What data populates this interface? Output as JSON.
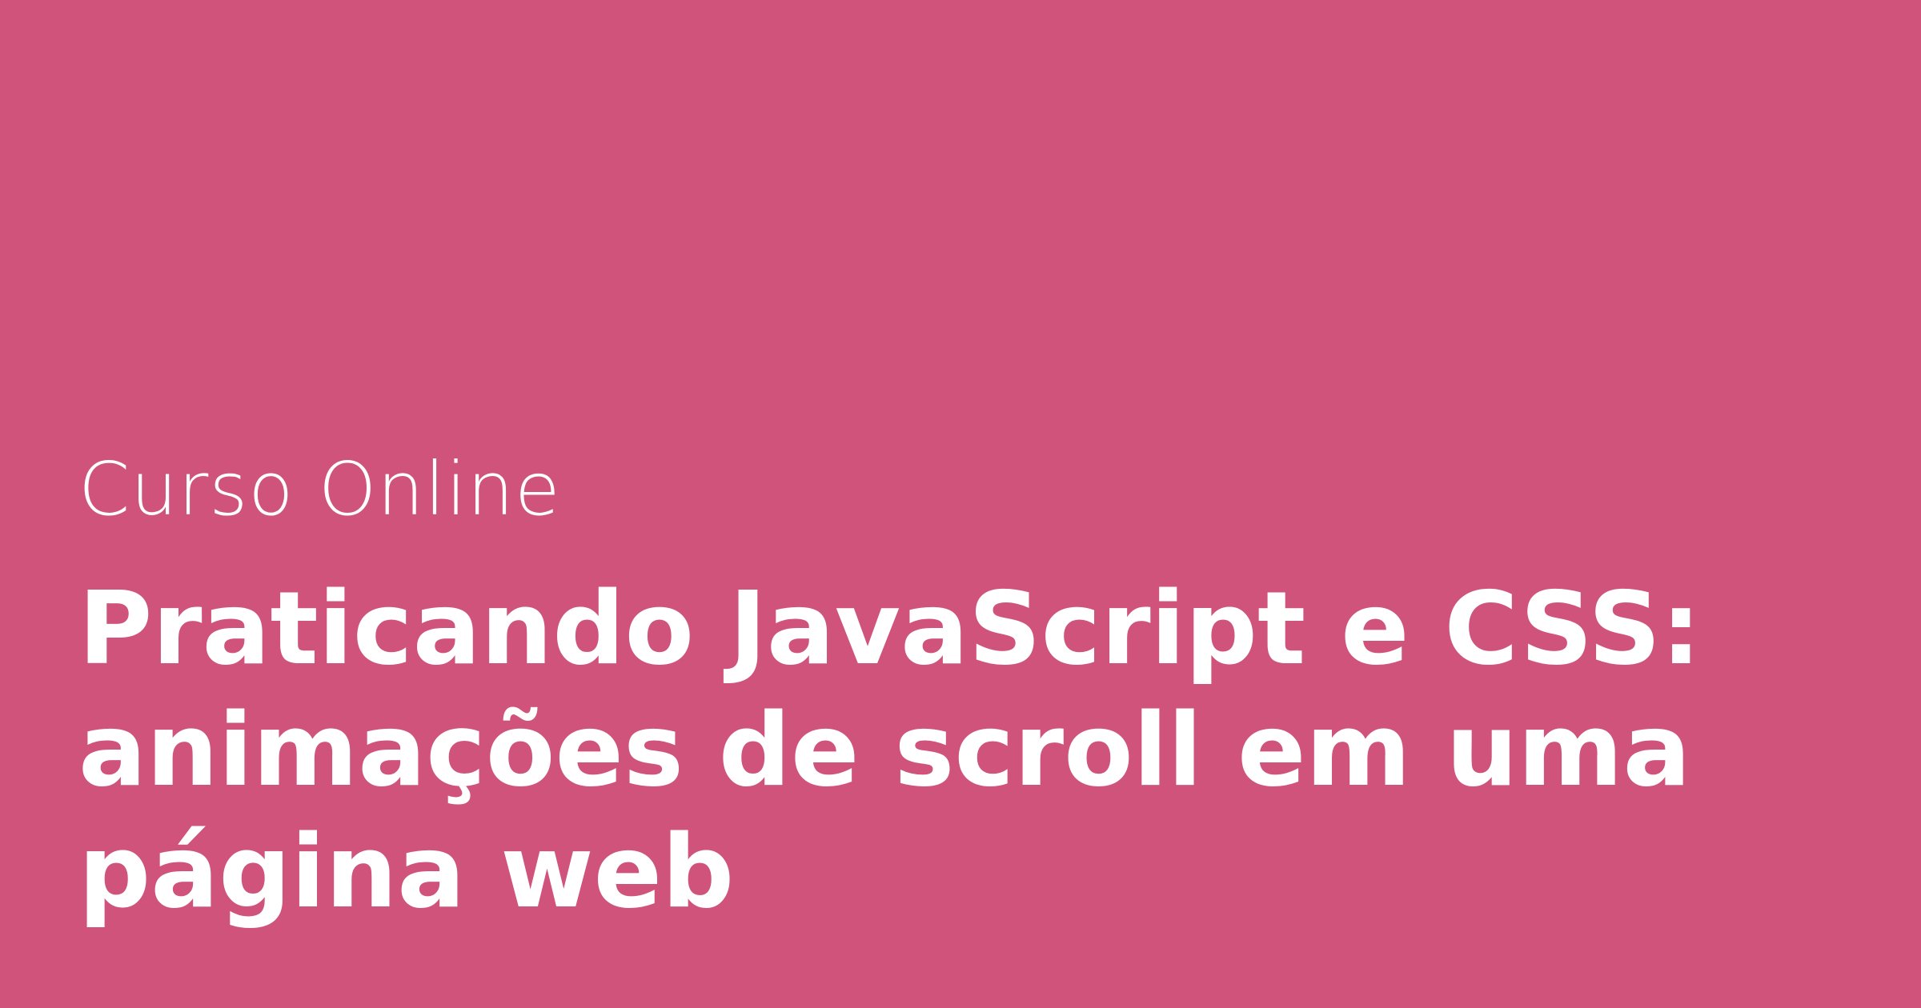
{
  "card": {
    "eyebrow": "Curso Online",
    "title": "Praticando JavaScript e CSS: animações de scroll em uma página web",
    "colors": {
      "background": "#cf537b",
      "text": "#ffffff"
    }
  }
}
